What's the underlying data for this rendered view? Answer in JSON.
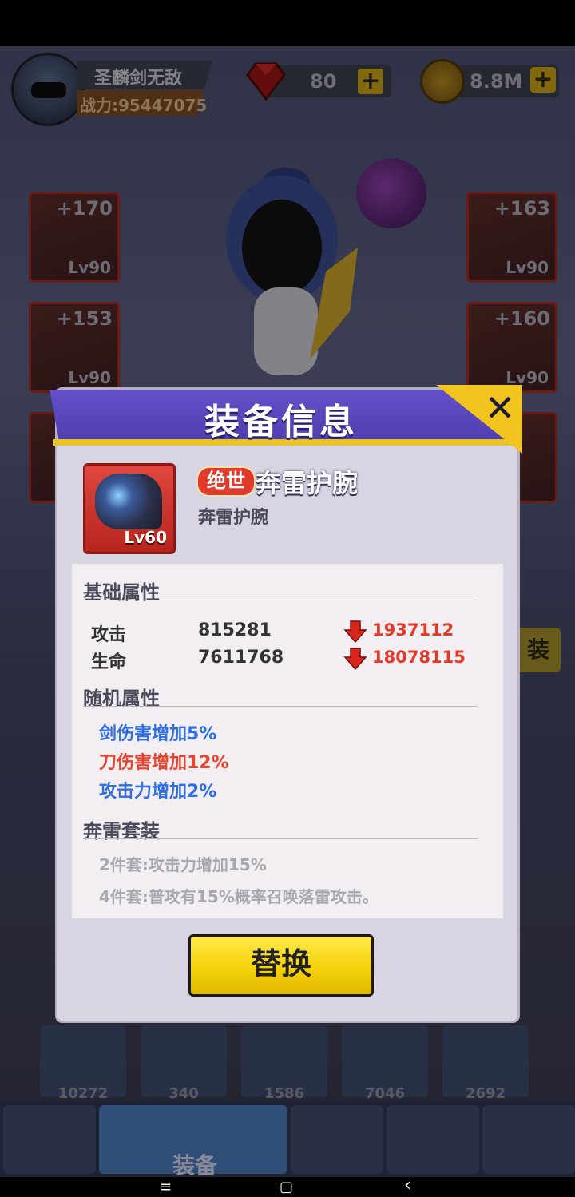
{
  "player": {
    "name": "圣麟剑无敌",
    "power": "战力:95447075"
  },
  "resources": {
    "gems": "80",
    "gold": "8.8M",
    "plus": "+"
  },
  "slots": {
    "left_top": {
      "plus": "+170",
      "lv": "Lv90"
    },
    "left_mid": {
      "plus": "+153",
      "lv": "Lv90"
    },
    "right_top": {
      "plus": "+163",
      "lv": "Lv90"
    },
    "right_mid": {
      "plus": "+160",
      "lv": "Lv90"
    }
  },
  "side_button": "装",
  "modal": {
    "title": "装备信息",
    "close": "✕",
    "item": {
      "rarity": "绝世",
      "name": "奔雷护腕",
      "subname": "奔雷护腕",
      "level": "Lv60"
    },
    "sections": {
      "base": "基础属性",
      "random": "随机属性",
      "set": "奔雷套装"
    },
    "stats": [
      {
        "name": "攻击",
        "value": "815281",
        "compare": "1937112"
      },
      {
        "name": "生命",
        "value": "7611768",
        "compare": "18078115"
      }
    ],
    "random_attrs": [
      {
        "text": "剑伤害增加5%",
        "color": "#2f6fe0"
      },
      {
        "text": "刀伤害增加12%",
        "color": "#e6462e"
      },
      {
        "text": "攻击力增加2%",
        "color": "#2f6fe0"
      }
    ],
    "set_bonuses": [
      "2件套:攻击力增加15%",
      "4件套:普攻有15%概率召唤落雷攻击。"
    ],
    "replace_button": "替换"
  },
  "bottom": {
    "scroll_counts": [
      "10272",
      "340",
      "1586",
      "7046",
      "2692"
    ],
    "nav_label": "装备"
  },
  "system_nav": {
    "menu": "≡",
    "home": "▢",
    "back": "‹"
  }
}
